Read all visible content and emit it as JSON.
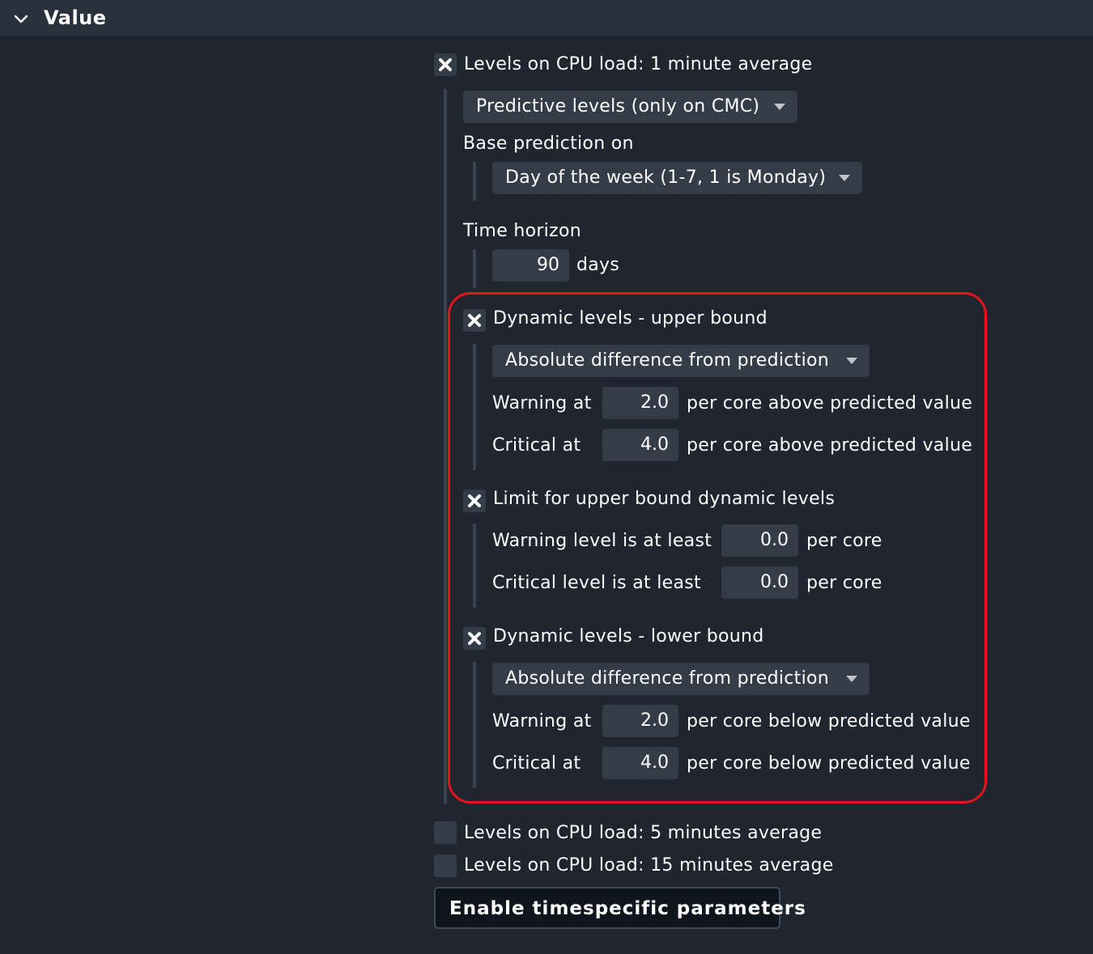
{
  "header": {
    "title": "Value"
  },
  "cpu1": {
    "label": "Levels on CPU load: 1 minute average",
    "mode_dropdown": "Predictive levels (only on CMC)",
    "base_prediction_label": "Base prediction on",
    "base_prediction_dropdown": "Day of the week (1-7, 1 is Monday)",
    "time_horizon_label": "Time horizon",
    "time_horizon_value": "90",
    "time_horizon_unit": "days",
    "upper": {
      "label": "Dynamic levels - upper bound",
      "dropdown": "Absolute difference from prediction",
      "warn_label": "Warning at",
      "warn_value": "2.0",
      "warn_unit": "per core above predicted value",
      "crit_label": "Critical at",
      "crit_value": "4.0",
      "crit_unit": "per core above predicted value"
    },
    "limit": {
      "label": "Limit for upper bound dynamic levels",
      "warn_label": "Warning level is at least",
      "warn_value": "0.0",
      "warn_unit": "per core",
      "crit_label": "Critical level is at least",
      "crit_value": "0.0",
      "crit_unit": "per core"
    },
    "lower": {
      "label": "Dynamic levels - lower bound",
      "dropdown": "Absolute difference from prediction",
      "warn_label": "Warning at",
      "warn_value": "2.0",
      "warn_unit": "per core below predicted value",
      "crit_label": "Critical at",
      "crit_value": "4.0",
      "crit_unit": "per core below predicted value"
    }
  },
  "cpu5": {
    "label": "Levels on CPU load: 5 minutes average"
  },
  "cpu15": {
    "label": "Levels on CPU load: 15 minutes average"
  },
  "button": {
    "label": "Enable timespecific parameters"
  },
  "colors": {
    "highlight": "#e3141b",
    "background": "#1f2630",
    "input": "#343c48"
  }
}
